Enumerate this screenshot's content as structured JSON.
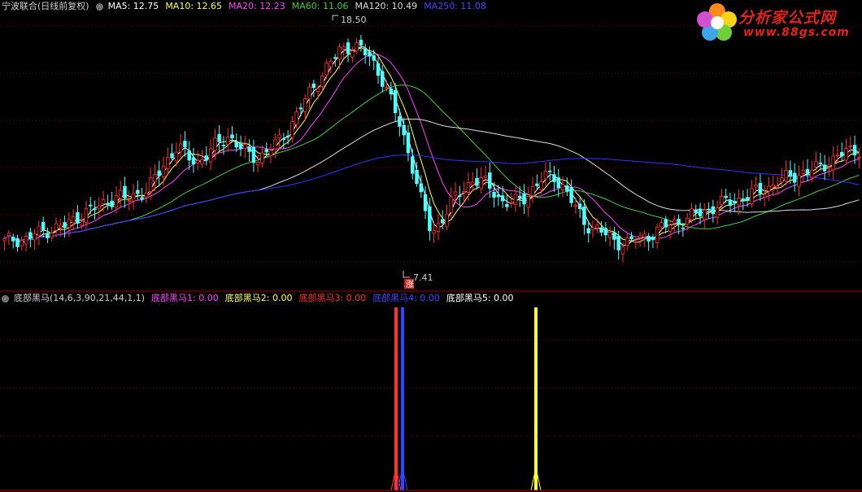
{
  "top_legend": {
    "stock": "宁波联合(日线前复权)",
    "items": [
      {
        "label": "MA5: 12.75",
        "color": "#ffffff"
      },
      {
        "label": "MA10: 12.65",
        "color": "#ffff66"
      },
      {
        "label": "MA20: 12.23",
        "color": "#ff44ff"
      },
      {
        "label": "MA60: 11.06",
        "color": "#44cc44"
      },
      {
        "label": "MA120: 10.49",
        "color": "#dddddd"
      },
      {
        "label": "MA250: 11.08",
        "color": "#3333ff"
      }
    ]
  },
  "sub_legend": {
    "title": "底部黑马(14,6,3,90,21,44,1,1)",
    "items": [
      {
        "label": "底部黑马1: 0.00",
        "color": "#ff44ff"
      },
      {
        "label": "底部黑马2: 0.00",
        "color": "#ffff66"
      },
      {
        "label": "底部黑马3: 0.00",
        "color": "#ff3333"
      },
      {
        "label": "底部黑马4: 0.00",
        "color": "#4444ff"
      },
      {
        "label": "底部黑马5: 0.00",
        "color": "#ffffff"
      }
    ]
  },
  "price_labels": {
    "high": "18.50",
    "low": "7.41",
    "low_tag": "涨"
  },
  "logo": {
    "brand": "分析家公式网",
    "site": "www.88gs.com"
  },
  "chart_data": {
    "type": "candlestick",
    "y_range": [
      6.5,
      19.5
    ],
    "close_path": [
      8.2,
      8.4,
      8.3,
      8.6,
      8.8,
      8.9,
      9.0,
      9.4,
      9.7,
      9.9,
      10.2,
      10.5,
      10.3,
      10.6,
      10.8,
      11.5,
      12.3,
      13.0,
      12.4,
      12.2,
      12.6,
      13.1,
      13.5,
      13.0,
      12.5,
      12.4,
      12.8,
      13.2,
      13.9,
      14.8,
      15.6,
      16.4,
      17.1,
      17.7,
      18.0,
      17.8,
      17.3,
      16.5,
      15.2,
      13.8,
      12.2,
      10.2,
      8.6,
      9.4,
      10.2,
      10.8,
      11.3,
      11.2,
      10.8,
      10.2,
      10.1,
      10.4,
      10.9,
      11.4,
      11.5,
      10.9,
      10.0,
      9.2,
      8.9,
      8.6,
      8.3,
      8.1,
      8.3,
      8.5,
      8.7,
      9.0,
      9.2,
      9.3,
      9.6,
      9.8,
      10.0,
      10.2,
      10.3,
      10.5,
      10.7,
      10.9,
      11.2,
      11.4,
      11.6,
      11.7,
      11.9,
      12.2,
      12.5,
      12.7,
      12.8
    ],
    "signals": [
      {
        "name": "底部黑马3",
        "color": "#ff3333",
        "position": "red"
      },
      {
        "name": "底部黑马4",
        "color": "#3344ff",
        "position": "blue"
      },
      {
        "name": "底部黑马2",
        "color": "#ffff33",
        "position": "yellow"
      }
    ]
  }
}
